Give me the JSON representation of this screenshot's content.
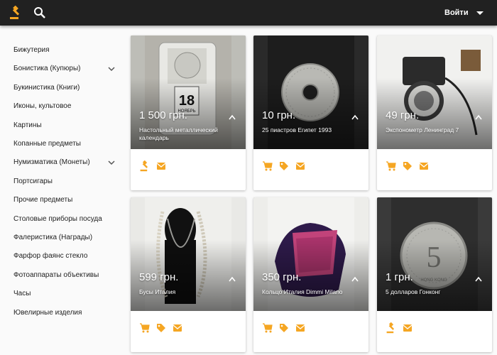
{
  "header": {
    "logo_icon": "auction-gavel-icon",
    "search_icon": "search-icon",
    "login_label": "Войти",
    "brand_color": "#f5a623",
    "bar_color": "#212121"
  },
  "sidebar": {
    "items": [
      {
        "label": "Бижутерия",
        "expandable": false
      },
      {
        "label": "Бонистика (Купюры)",
        "expandable": true
      },
      {
        "label": "Букинистика (Книги)",
        "expandable": false
      },
      {
        "label": "Иконы, культовое",
        "expandable": false
      },
      {
        "label": "Картины",
        "expandable": false
      },
      {
        "label": "Копанные предметы",
        "expandable": false
      },
      {
        "label": "Нумизматика (Монеты)",
        "expandable": true
      },
      {
        "label": "Портсигары",
        "expandable": false
      },
      {
        "label": "Прочие предметы",
        "expandable": false
      },
      {
        "label": "Столовые приборы посуда",
        "expandable": false
      },
      {
        "label": "Фалеристика (Награды)",
        "expandable": false
      },
      {
        "label": "Фарфор фаянс стекло",
        "expandable": false
      },
      {
        "label": "Фотоаппараты объективы",
        "expandable": false
      },
      {
        "label": "Часы",
        "expandable": false
      },
      {
        "label": "Ювелирные изделия",
        "expandable": false
      }
    ]
  },
  "cards": [
    {
      "price": "1 500 грн.",
      "title": "Настольный металлический календарь",
      "actions": [
        "auction-gavel-icon",
        "mail-icon"
      ]
    },
    {
      "price": "10 грн.",
      "title": "25 пиастров Египет 1993",
      "actions": [
        "cart-icon",
        "tag-icon",
        "mail-icon"
      ]
    },
    {
      "price": "49 грн.",
      "title": "Экспонометр Ленинград 7",
      "actions": [
        "cart-icon",
        "tag-icon",
        "mail-icon"
      ]
    },
    {
      "price": "599 грн.",
      "title": "Бусы Италия",
      "actions": [
        "cart-icon",
        "tag-icon",
        "mail-icon"
      ]
    },
    {
      "price": "350 грн.",
      "title": "Кольцо Италия Dimmi Milano",
      "actions": [
        "cart-icon",
        "tag-icon",
        "mail-icon"
      ]
    },
    {
      "price": "1 грн.",
      "title": "5 долларов Гонконг",
      "actions": [
        "auction-gavel-icon",
        "mail-icon"
      ]
    }
  ],
  "photo_text": {
    "calendar_day": "18",
    "calendar_month": "НОЯБРЬ",
    "coin_number": "5",
    "coin_legend": "HONG KONG"
  }
}
